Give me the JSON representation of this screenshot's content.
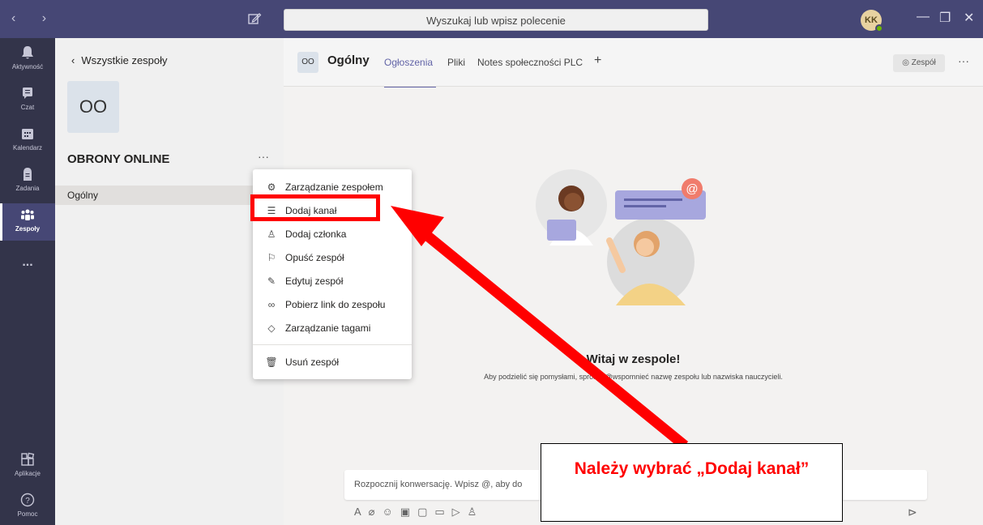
{
  "titlebar": {
    "search_placeholder": "Wyszukaj lub wpisz polecenie",
    "user_initials": "KK",
    "accent": "#464775"
  },
  "rail": {
    "items": [
      {
        "label": "Aktywność",
        "icon": "bell-icon"
      },
      {
        "label": "Czat",
        "icon": "chat-icon"
      },
      {
        "label": "Kalendarz",
        "icon": "calendar-icon"
      },
      {
        "label": "Zadania",
        "icon": "assignments-icon"
      },
      {
        "label": "Zespoły",
        "icon": "teams-icon",
        "active": true
      }
    ],
    "more": "...",
    "bottom": [
      {
        "label": "Aplikacje",
        "icon": "apps-icon"
      },
      {
        "label": "Pomoc",
        "icon": "help-icon"
      }
    ]
  },
  "teampanel": {
    "back_label": "Wszystkie zespoły",
    "team_initials": "OO",
    "team_name": "OBRONY ONLINE",
    "channel": "Ogólny"
  },
  "header": {
    "channel_initials": "OO",
    "channel_title": "Ogólny",
    "tabs": [
      "Ogłoszenia",
      "Pliki",
      "Notes społeczności PLC",
      "+"
    ],
    "team_button": "Zespół"
  },
  "menu": {
    "items": [
      {
        "label": "Zarządzanie zespołem",
        "icon": "gear-icon"
      },
      {
        "label": "Dodaj kanał",
        "icon": "add-channel-icon"
      },
      {
        "label": "Dodaj członka",
        "icon": "add-member-icon"
      },
      {
        "label": "Opuść zespół",
        "icon": "leave-icon"
      },
      {
        "label": "Edytuj zespół",
        "icon": "pencil-icon"
      },
      {
        "label": "Pobierz link do zespołu",
        "icon": "link-icon"
      },
      {
        "label": "Zarządzanie tagami",
        "icon": "tag-icon"
      },
      {
        "label": "Usuń zespół",
        "icon": "trash-icon"
      }
    ]
  },
  "content": {
    "welcome_title": "Witaj w zespole!",
    "welcome_sub": "Aby podzielić się pomysłami, spróbuj @wspomnieć nazwę zespołu lub nazwiska nauczycieli.",
    "compose_placeholder": "Rozpocznij konwersację. Wpisz @, aby do"
  },
  "annotation": {
    "callout": "Należy wybrać „Dodaj kanał”",
    "color": "#ff0000"
  }
}
